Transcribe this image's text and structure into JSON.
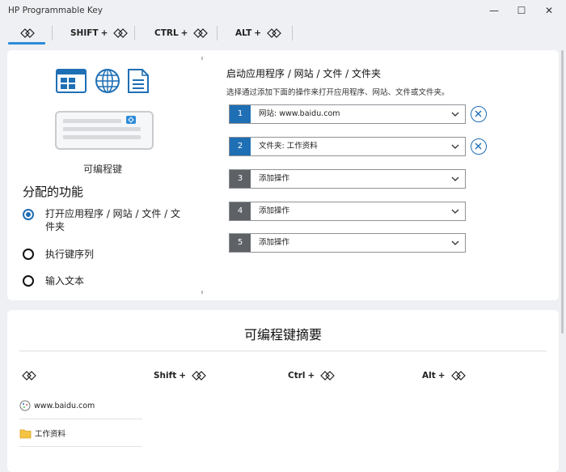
{
  "window": {
    "title": "HP Programmable Key",
    "controls": {
      "minimize": "—",
      "maximize": "☐",
      "close": "✕"
    }
  },
  "tabs": [
    {
      "modifier": "",
      "active": true
    },
    {
      "modifier": "SHIFT",
      "plus": "+",
      "active": false
    },
    {
      "modifier": "CTRL",
      "plus": "+",
      "active": false
    },
    {
      "modifier": "ALT",
      "plus": "+",
      "active": false
    }
  ],
  "left_panel": {
    "icons": [
      "window-app-icon",
      "globe-icon",
      "document-icon",
      "keycap-icon"
    ],
    "key_label": "可编程键",
    "assign_title": "分配的功能",
    "options": [
      {
        "label_line1": "打开应用程序 / 网站 / 文件 / 文",
        "label_line2": "件夹",
        "checked": true
      },
      {
        "label_line1": "执行键序列",
        "checked": false
      },
      {
        "label_line1": "输入文本",
        "checked": false
      }
    ]
  },
  "right_panel": {
    "title": "启动应用程序 / 网站 / 文件 / 文件夹",
    "description": "选择通过添加下面的操作来打开应用程序、网站、文件或文件夹。",
    "actions": [
      {
        "number": "1",
        "text": "网站: www.baidu.com",
        "assigned": true
      },
      {
        "number": "2",
        "text": "文件夹: 工作资料",
        "assigned": true
      },
      {
        "number": "3",
        "text": "添加操作",
        "assigned": false
      },
      {
        "number": "4",
        "text": "添加操作",
        "assigned": false
      },
      {
        "number": "5",
        "text": "添加操作",
        "assigned": false
      }
    ]
  },
  "summary": {
    "title": "可编程键摘要",
    "columns": [
      {
        "modifier": ""
      },
      {
        "modifier": "Shift",
        "plus": "+"
      },
      {
        "modifier": "Ctrl",
        "plus": "+"
      },
      {
        "modifier": "Alt",
        "plus": "+"
      }
    ],
    "items": [
      {
        "icon": "website-icon",
        "text": "www.baidu.com"
      },
      {
        "icon": "folder-icon",
        "text": "工作资料"
      }
    ]
  },
  "colors": {
    "accent": "#1f6fb5",
    "tab_underline": "#2d8bd9",
    "inactive_number": "#5e6165",
    "background": "#eef0f3"
  }
}
